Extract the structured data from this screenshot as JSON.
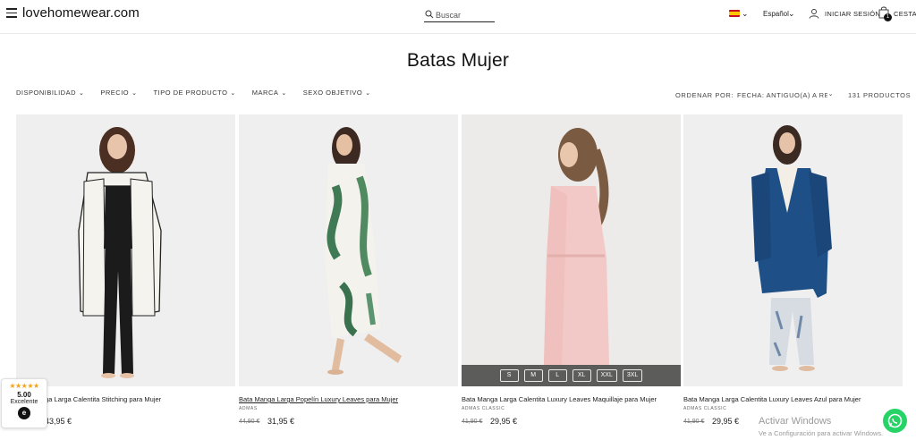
{
  "header": {
    "logo": "lovehomewear.com",
    "search_placeholder": "Buscar",
    "language": "Español",
    "login_label": "INICIAR SESIÓN",
    "cart_label": "CESTA",
    "cart_count": "1"
  },
  "page": {
    "title": "Batas Mujer"
  },
  "filters": [
    {
      "label": "DISPONIBILIDAD"
    },
    {
      "label": "PRECIO"
    },
    {
      "label": "TIPO DE PRODUCTO"
    },
    {
      "label": "MARCA"
    },
    {
      "label": "SEXO OBJETIVO"
    }
  ],
  "sort": {
    "label": "ORDENAR POR:",
    "value": "FECHA: ANTIGUO(A) A RECIENTE",
    "count": "131 PRODUCTOS"
  },
  "products": [
    {
      "name": "Bata Manga Larga Calentita Stitching para Mujer",
      "brand": "",
      "old_price": "",
      "price": "43,95 €"
    },
    {
      "name": "Bata Manga Larga Popelín Luxury Leaves para Mujer",
      "brand": "ADMAS",
      "old_price": "44,90 €",
      "price": "31,95 €"
    },
    {
      "name": "Bata Manga Larga Calentita Luxury Leaves Maquillaje para Mujer",
      "brand": "ADMAS CLASSIC",
      "old_price": "41,90 €",
      "price": "29,95 €"
    },
    {
      "name": "Bata Manga Larga Calentita Luxury Leaves Azul para Mujer",
      "brand": "ADMAS CLASSIC",
      "old_price": "41,90 €",
      "price": "29,95 €"
    }
  ],
  "sizes": [
    "S",
    "M",
    "L",
    "XL",
    "XXL",
    "3XL"
  ],
  "trust_badge": {
    "stars": "★★★★★",
    "score": "5.00",
    "label": "Excelente"
  },
  "watermark": {
    "line1": "Activar Windows",
    "line2": "Ve a Configuración para activar Windows."
  },
  "colors": {
    "accent_whatsapp": "#25d366",
    "star": "#f4a31a",
    "product_bg": "#efefef",
    "robe_navy": "#1e4f86",
    "robe_pink": "#f2c9c6"
  }
}
